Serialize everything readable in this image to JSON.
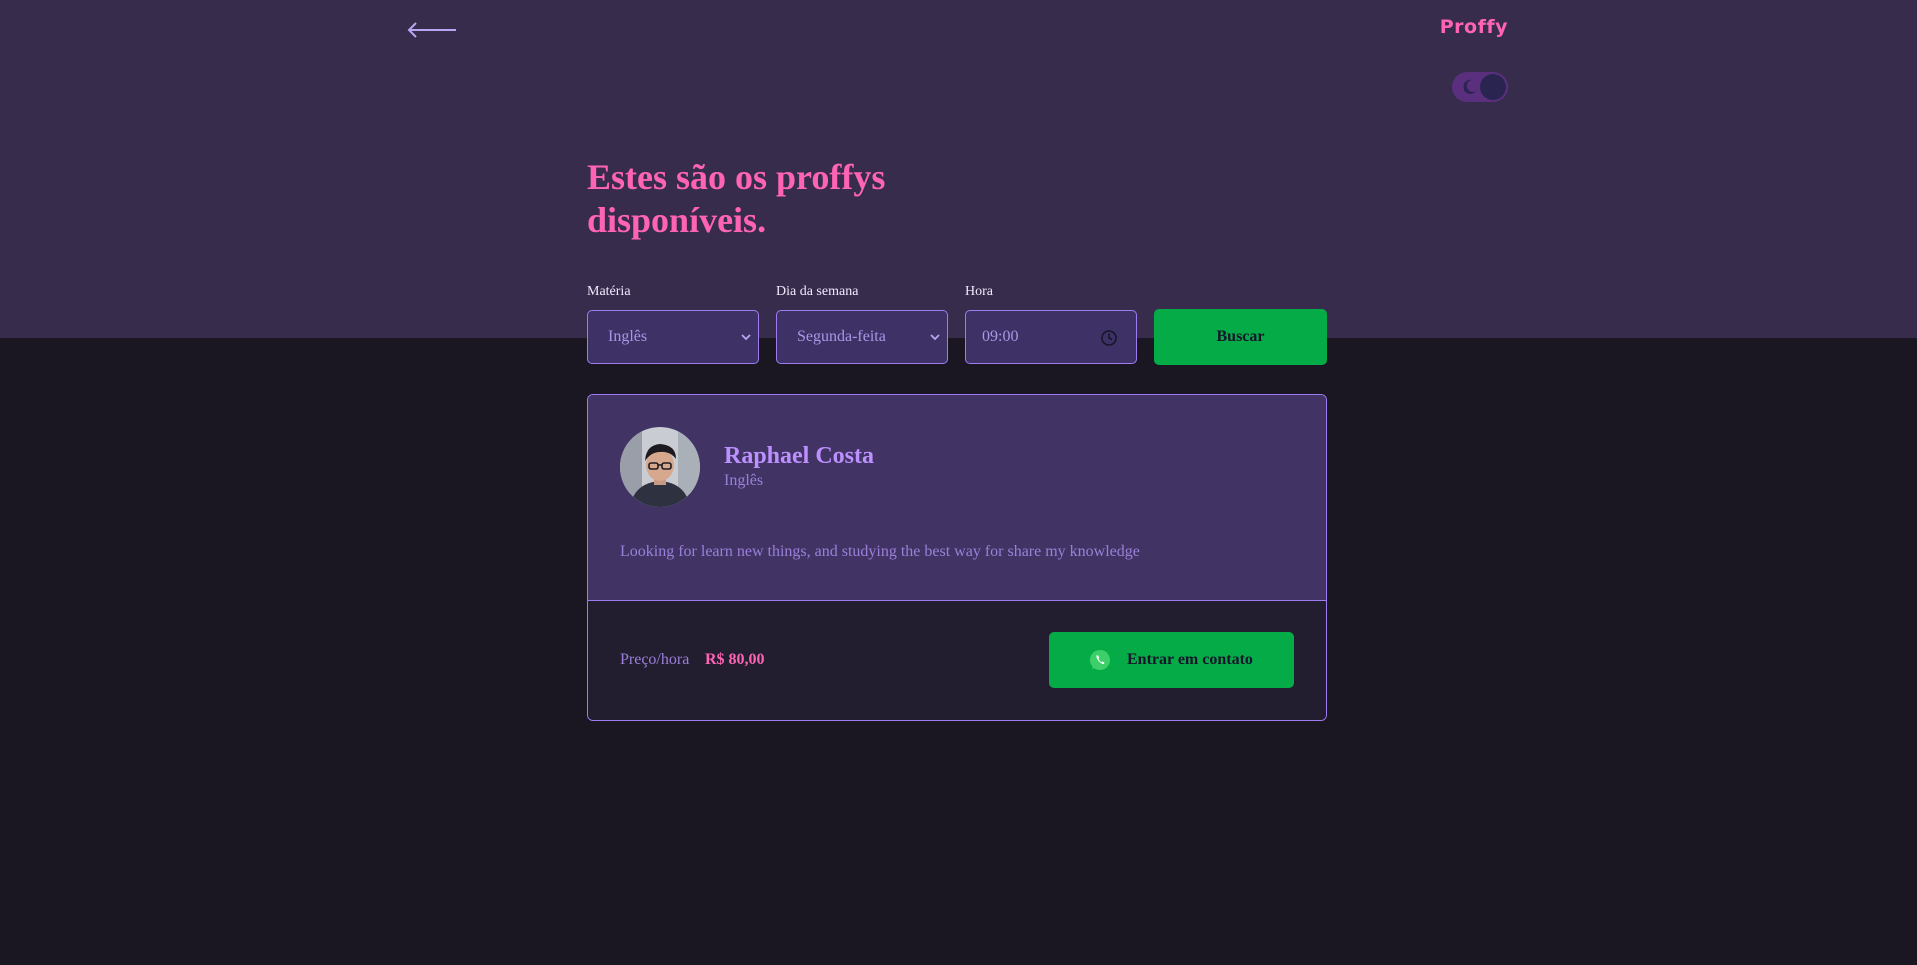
{
  "header": {
    "brand": "Proffy",
    "title": "Estes são os proffys disponíveis."
  },
  "filters": {
    "subject": {
      "label": "Matéria",
      "value": "Inglês"
    },
    "weekday": {
      "label": "Dia da semana",
      "value": "Segunda-feita"
    },
    "time": {
      "label": "Hora",
      "value": "09:00"
    },
    "search_label": "Buscar"
  },
  "teacher": {
    "name": "Raphael Costa",
    "subject": "Inglês",
    "bio": "Looking for learn new things, and studying the best way for share my knowledge",
    "price_label": "Preço/hora",
    "price_value": "R$ 80,00",
    "contact_label": "Entrar em contato"
  },
  "colors": {
    "accent_pink": "#ff64b4",
    "accent_purple": "#9d7cf2",
    "button_green": "#04ab47",
    "header_bg": "#372c4c",
    "page_bg": "#1a1722"
  },
  "icons": {
    "back": "arrow-left-icon",
    "theme": "moon-icon",
    "time": "clock-icon",
    "select": "chevron-down-icon",
    "contact": "whatsapp-icon"
  }
}
